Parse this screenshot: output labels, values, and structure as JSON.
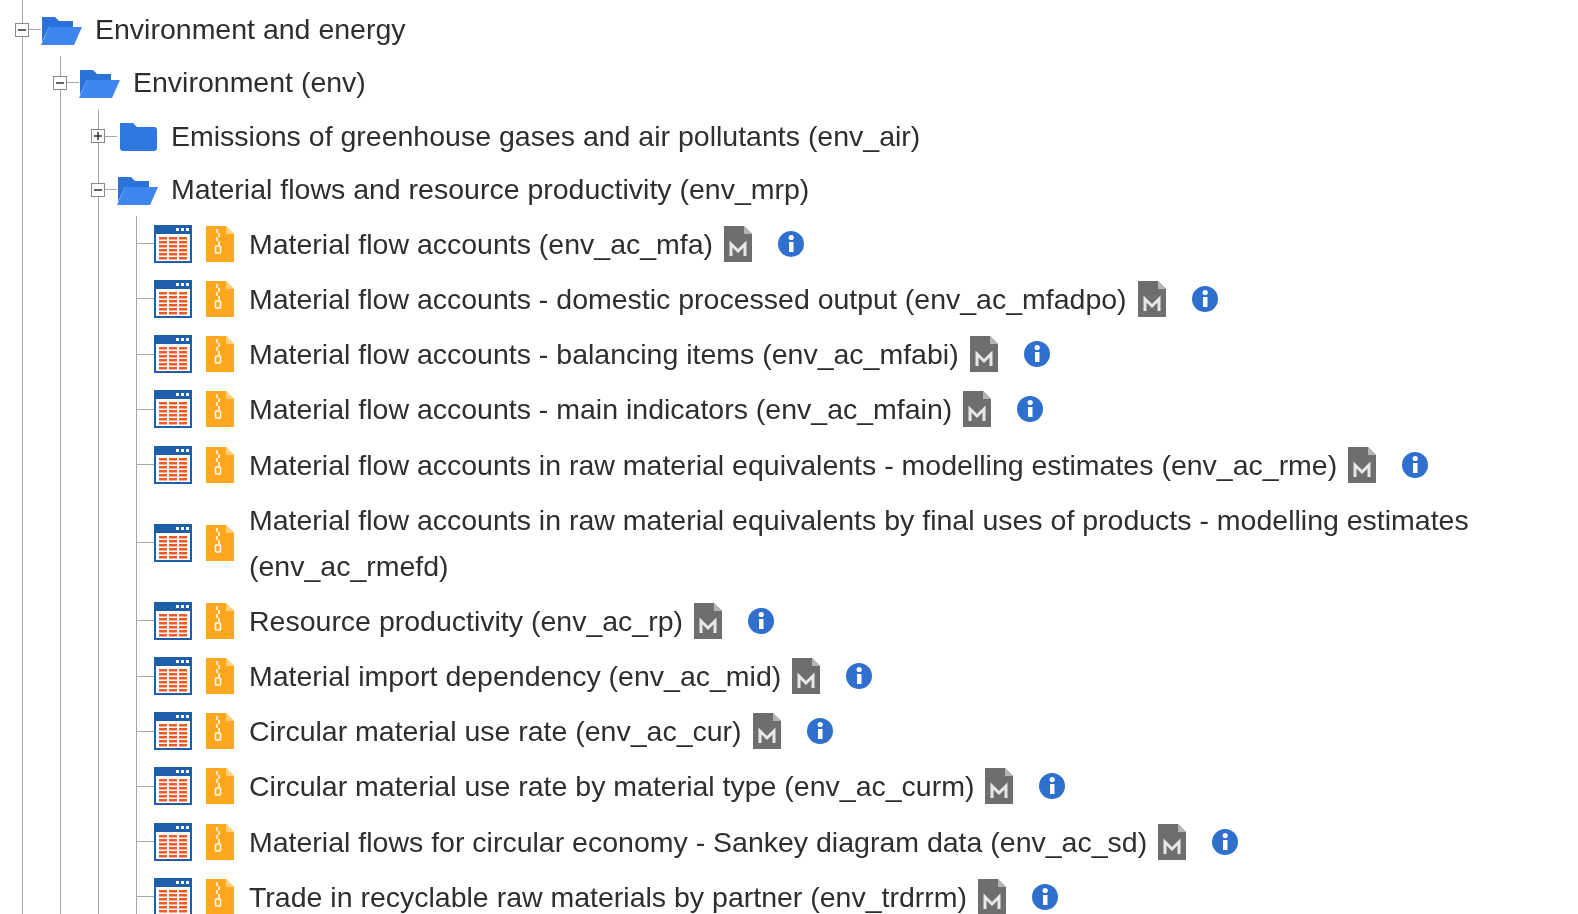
{
  "tree": [
    {
      "kind": "folder",
      "label": "Environment and energy",
      "expanded": true,
      "children": [
        {
          "kind": "folder",
          "label": "Environment (env)",
          "expanded": true,
          "children": [
            {
              "kind": "folder",
              "label": "Emissions of greenhouse gases and air pollutants (env_air)",
              "expanded": false
            },
            {
              "kind": "folder",
              "label": "Material flows and resource productivity (env_mrp)",
              "expanded": true,
              "children": [
                {
                  "kind": "dataset",
                  "label": "Material flow accounts (env_ac_mfa)",
                  "metadata_icons": true
                },
                {
                  "kind": "dataset",
                  "label": "Material flow accounts - domestic processed output (env_ac_mfadpo)",
                  "metadata_icons": true
                },
                {
                  "kind": "dataset",
                  "label": "Material flow accounts - balancing items (env_ac_mfabi)",
                  "metadata_icons": true
                },
                {
                  "kind": "dataset",
                  "label": "Material flow accounts - main indicators (env_ac_mfain)",
                  "metadata_icons": true
                },
                {
                  "kind": "dataset",
                  "label": "Material flow accounts in raw material equivalents - modelling estimates (env_ac_rme)",
                  "metadata_icons": true
                },
                {
                  "kind": "dataset",
                  "label": "Material flow accounts in raw material equivalents by final uses of products - modelling estimates (env_ac_rmefd)",
                  "metadata_icons": false
                },
                {
                  "kind": "dataset",
                  "label": "Resource productivity (env_ac_rp)",
                  "metadata_icons": true
                },
                {
                  "kind": "dataset",
                  "label": "Material import dependency (env_ac_mid)",
                  "metadata_icons": true
                },
                {
                  "kind": "dataset",
                  "label": "Circular material use rate (env_ac_cur)",
                  "metadata_icons": true
                },
                {
                  "kind": "dataset",
                  "label": "Circular material use rate by material type (env_ac_curm)",
                  "metadata_icons": true
                },
                {
                  "kind": "dataset",
                  "label": "Material flows for circular economy - Sankey diagram data (env_ac_sd)",
                  "metadata_icons": true
                },
                {
                  "kind": "dataset",
                  "label": "Trade in recyclable raw materials by partner (env_trdrrm)",
                  "metadata_icons": true
                }
              ]
            }
          ]
        }
      ]
    }
  ]
}
